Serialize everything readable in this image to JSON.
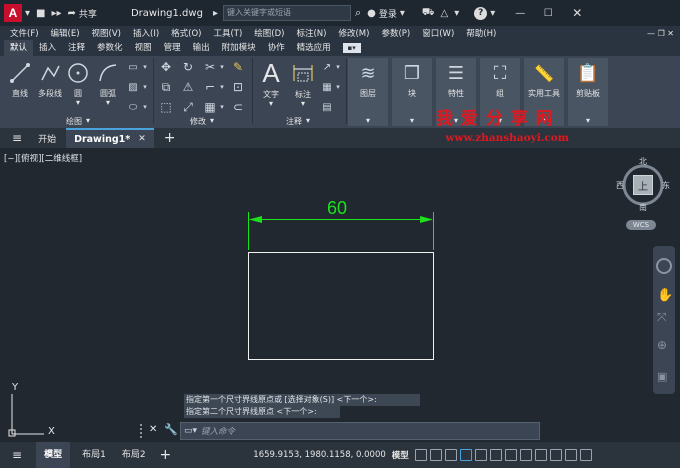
{
  "title_bar": {
    "app_icon_letter": "A",
    "share_label": "共享",
    "doc_title": "Drawing1.dwg",
    "search_placeholder": "键入关键字或短语",
    "login_label": "登录",
    "help_glyph": "?"
  },
  "menu": [
    "文件(F)",
    "编辑(E)",
    "视图(V)",
    "插入(I)",
    "格式(O)",
    "工具(T)",
    "绘图(D)",
    "标注(N)",
    "修改(M)",
    "参数(P)",
    "窗口(W)",
    "帮助(H)"
  ],
  "ribbon_tabs": [
    "默认",
    "插入",
    "注释",
    "参数化",
    "视图",
    "管理",
    "输出",
    "附加模块",
    "协作",
    "精选应用"
  ],
  "active_ribbon_tab": "默认",
  "ribbon": {
    "draw_buttons": [
      "直线",
      "多段线",
      "圆",
      "圆弧"
    ],
    "text_label": "文字",
    "dim_label": "标注",
    "layer_label": "图层",
    "block_label": "块",
    "props_label": "特性",
    "group_label": "组",
    "util_label": "实用工具",
    "clip_label": "剪贴板",
    "panel_draw": "绘图",
    "panel_modify": "修改",
    "panel_annot": "注释"
  },
  "watermark": {
    "cn": "我 爱 分 享 网",
    "url": "www.zhanshaoyi.com"
  },
  "doc_tabs": {
    "start": "开始",
    "drawing": "Drawing1*"
  },
  "viewport_label": "[−][俯视][二维线框]",
  "dimension_value": "60",
  "viewcube": {
    "north": "北",
    "south": "南",
    "east": "东",
    "west": "西",
    "top": "上",
    "wcs": "WCS"
  },
  "ucs": {
    "y": "Y",
    "x": "X"
  },
  "command_history": [
    "指定第一个尺寸界线原点或 [选择对象(S)] <下一个>:",
    "指定第二个尺寸界线原点 <下一个>:"
  ],
  "command_placeholder": "键入命令",
  "status": {
    "tabs": [
      "模型",
      "布局1",
      "布局2"
    ],
    "coords": "1659.9153, 1980.1158, 0.0000",
    "model_label": "模型"
  }
}
